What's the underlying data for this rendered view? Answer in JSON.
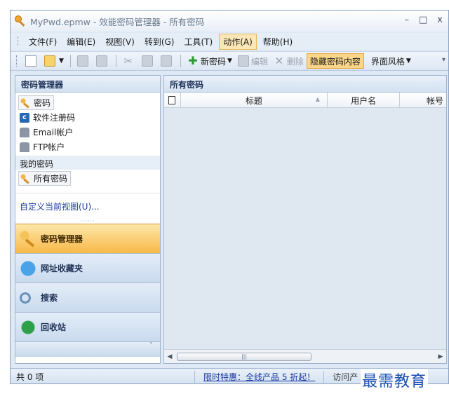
{
  "window": {
    "title": "MyPwd.epmw - 效能密码管理器 - 所有密码",
    "controls": {
      "minimize": "–",
      "maximize": "□",
      "close": "x"
    }
  },
  "menubar": {
    "items": [
      {
        "label": "文件(F)"
      },
      {
        "label": "编辑(E)"
      },
      {
        "label": "视图(V)"
      },
      {
        "label": "转到(G)"
      },
      {
        "label": "工具(T)"
      },
      {
        "label": "动作(A)"
      },
      {
        "label": "帮助(H)"
      }
    ]
  },
  "toolbar": {
    "new_password": "新密码",
    "edit": "编辑",
    "delete": "删除",
    "hide_content": "隐藏密码内容",
    "ui_style": "界面风格"
  },
  "sidebar": {
    "header": "密码管理器",
    "items": [
      {
        "label": "密码",
        "icon": "key-icon"
      },
      {
        "label": "软件注册码",
        "icon": "c-app-icon"
      },
      {
        "label": "Email帐户",
        "icon": "user-icon"
      },
      {
        "label": "FTP帐户",
        "icon": "user-icon"
      }
    ],
    "section_label": "我的密码",
    "my_items": [
      {
        "label": "所有密码",
        "icon": "key-icon"
      }
    ],
    "customize_link": "自定义当前视图(U)...",
    "buttons": [
      {
        "label": "密码管理器",
        "icon": "key-icon"
      },
      {
        "label": "网址收藏夹",
        "icon": "globe-icon"
      },
      {
        "label": "搜索",
        "icon": "search-icon"
      },
      {
        "label": "回收站",
        "icon": "recycle-icon"
      }
    ]
  },
  "main": {
    "header": "所有密码",
    "columns": [
      {
        "label": "标题"
      },
      {
        "label": "用户名"
      },
      {
        "label": "帐号"
      }
    ]
  },
  "statusbar": {
    "count": "共 0 项",
    "promo": "限时特惠：全线产品 5 折起！",
    "more": "访问产"
  },
  "watermark": "最需教育",
  "colors": {
    "accent_orange": "#f8b848",
    "link_blue": "#1a3aa0",
    "pane_bg": "#dfe7f1"
  }
}
